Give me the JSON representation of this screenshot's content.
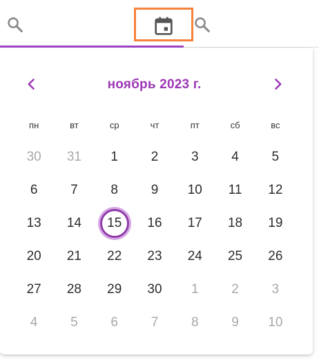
{
  "colors": {
    "accent": "#9c37b5",
    "focus_outline": "#f5813a",
    "muted_text": "#a8a8a8"
  },
  "toolbar": {
    "icons": [
      "search-icon",
      "calendar-icon",
      "search-icon"
    ]
  },
  "calendar": {
    "month_title": "ноябрь 2023 г.",
    "prev_icon": "chevron-left-icon",
    "next_icon": "chevron-right-icon",
    "weekdays": [
      "пн",
      "вт",
      "ср",
      "чт",
      "пт",
      "сб",
      "вс"
    ],
    "selected_day": "15",
    "weeks": [
      [
        {
          "d": "30",
          "m": true
        },
        {
          "d": "31",
          "m": true
        },
        {
          "d": "1"
        },
        {
          "d": "2"
        },
        {
          "d": "3"
        },
        {
          "d": "4"
        },
        {
          "d": "5"
        }
      ],
      [
        {
          "d": "6"
        },
        {
          "d": "7"
        },
        {
          "d": "8"
        },
        {
          "d": "9"
        },
        {
          "d": "10"
        },
        {
          "d": "11"
        },
        {
          "d": "12"
        }
      ],
      [
        {
          "d": "13"
        },
        {
          "d": "14"
        },
        {
          "d": "15",
          "s": true
        },
        {
          "d": "16"
        },
        {
          "d": "17"
        },
        {
          "d": "18"
        },
        {
          "d": "19"
        }
      ],
      [
        {
          "d": "20"
        },
        {
          "d": "21"
        },
        {
          "d": "22"
        },
        {
          "d": "23"
        },
        {
          "d": "24"
        },
        {
          "d": "25"
        },
        {
          "d": "26"
        }
      ],
      [
        {
          "d": "27"
        },
        {
          "d": "28"
        },
        {
          "d": "29"
        },
        {
          "d": "30"
        },
        {
          "d": "1",
          "m": true
        },
        {
          "d": "2",
          "m": true
        },
        {
          "d": "3",
          "m": true
        }
      ],
      [
        {
          "d": "4",
          "m": true
        },
        {
          "d": "5",
          "m": true
        },
        {
          "d": "6",
          "m": true
        },
        {
          "d": "7",
          "m": true
        },
        {
          "d": "8",
          "m": true
        },
        {
          "d": "9",
          "m": true
        },
        {
          "d": "10",
          "m": true
        }
      ]
    ]
  }
}
